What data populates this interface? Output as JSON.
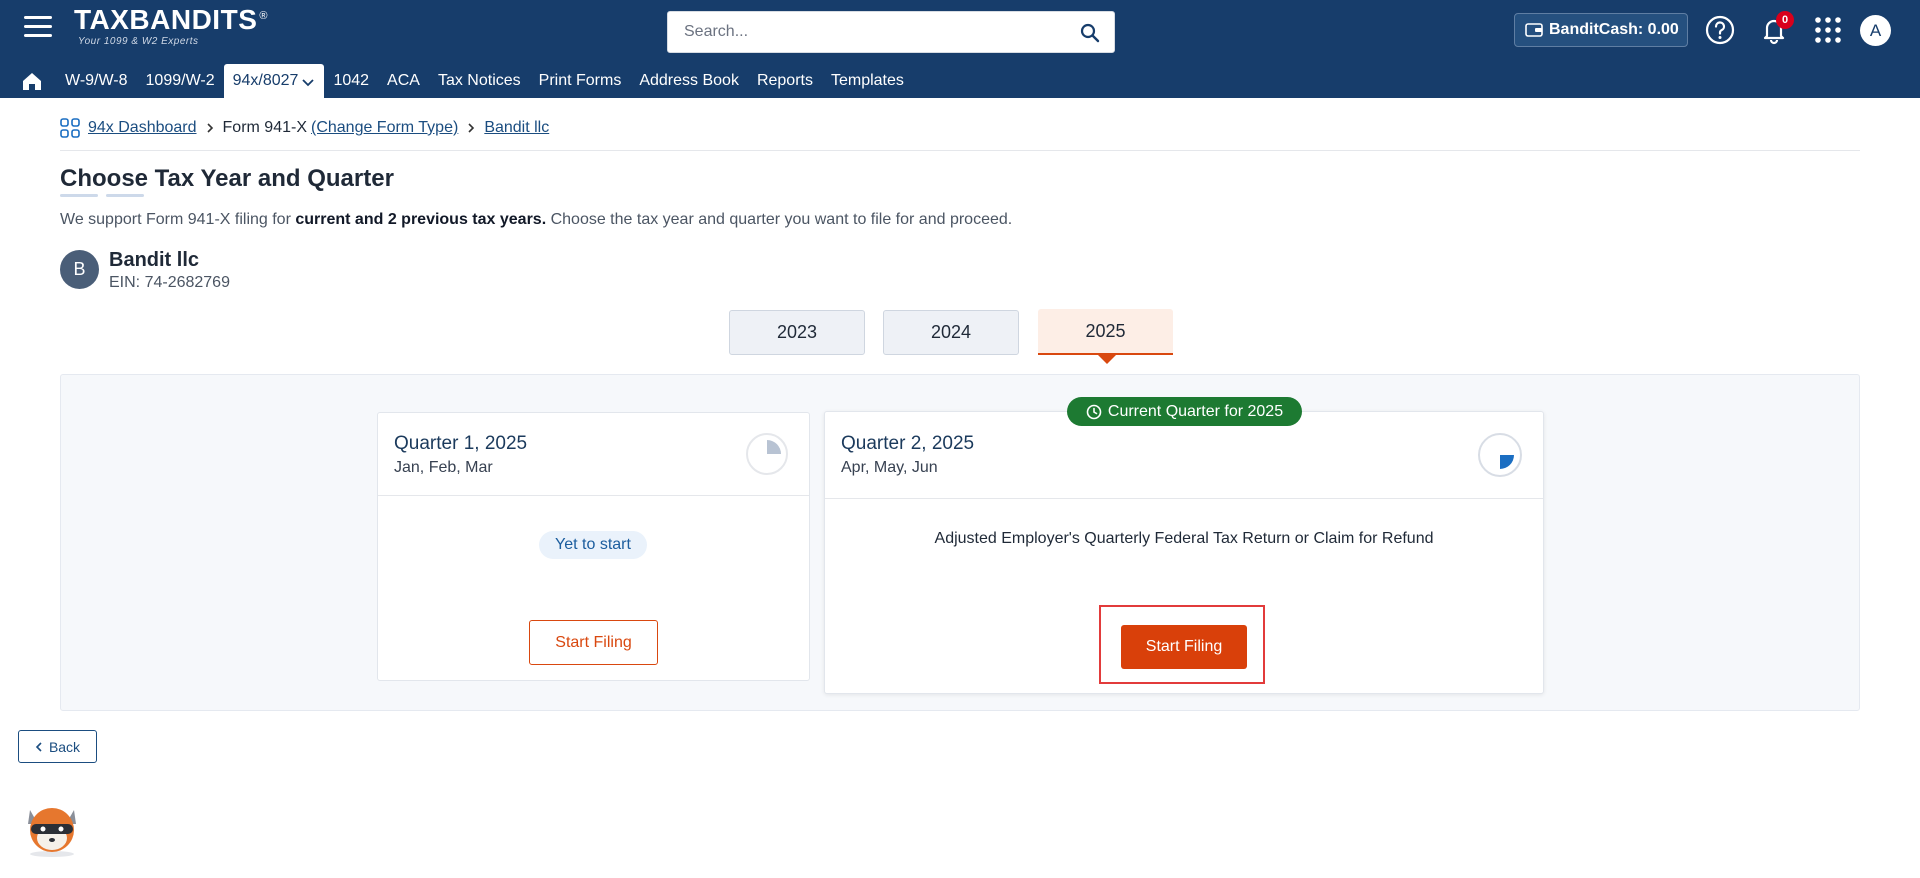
{
  "header": {
    "logo_text": "TAXBANDITS",
    "logo_reg": "®",
    "logo_tagline": "Your 1099 & W2 Experts",
    "search_placeholder": "Search...",
    "bandit_cash_label": "BanditCash: 0.00",
    "notification_count": "0",
    "user_initial": "A"
  },
  "nav": {
    "items": [
      {
        "label": "W-9/W-8"
      },
      {
        "label": "1099/W-2"
      },
      {
        "label": "94x/8027",
        "active": true
      },
      {
        "label": "1042"
      },
      {
        "label": "ACA"
      },
      {
        "label": "Tax Notices"
      },
      {
        "label": "Print Forms"
      },
      {
        "label": "Address Book"
      },
      {
        "label": "Reports"
      },
      {
        "label": "Templates"
      }
    ]
  },
  "breadcrumb": {
    "dashboard": "94x Dashboard",
    "form": "Form 941-X",
    "change_form": "(Change Form Type)",
    "company": "Bandit llc"
  },
  "page": {
    "title": "Choose Tax Year and Quarter",
    "desc_pre": "We support Form 941-X filing for ",
    "desc_bold": "current and 2 previous tax years.",
    "desc_post": " Choose the tax year and quarter you want to file for and proceed."
  },
  "company": {
    "initial": "B",
    "name": "Bandit llc",
    "ein": "EIN: 74-2682769"
  },
  "years": {
    "y1": "2023",
    "y2": "2024",
    "y3": "2025",
    "selected": "2025"
  },
  "quarters": {
    "q1": {
      "title": "Quarter 1, 2025",
      "months": "Jan, Feb, Mar",
      "status": "Yet to start",
      "button": "Start Filing"
    },
    "q2": {
      "badge": "Current Quarter for 2025",
      "title": "Quarter 2, 2025",
      "months": "Apr, May, Jun",
      "description": "Adjusted Employer's Quarterly Federal Tax Return or Claim for Refund",
      "button": "Start Filing"
    }
  },
  "footer": {
    "back": "Back"
  },
  "colors": {
    "header_bg": "#173d6b",
    "accent": "#d9400a",
    "current_badge": "#1d7a32"
  }
}
